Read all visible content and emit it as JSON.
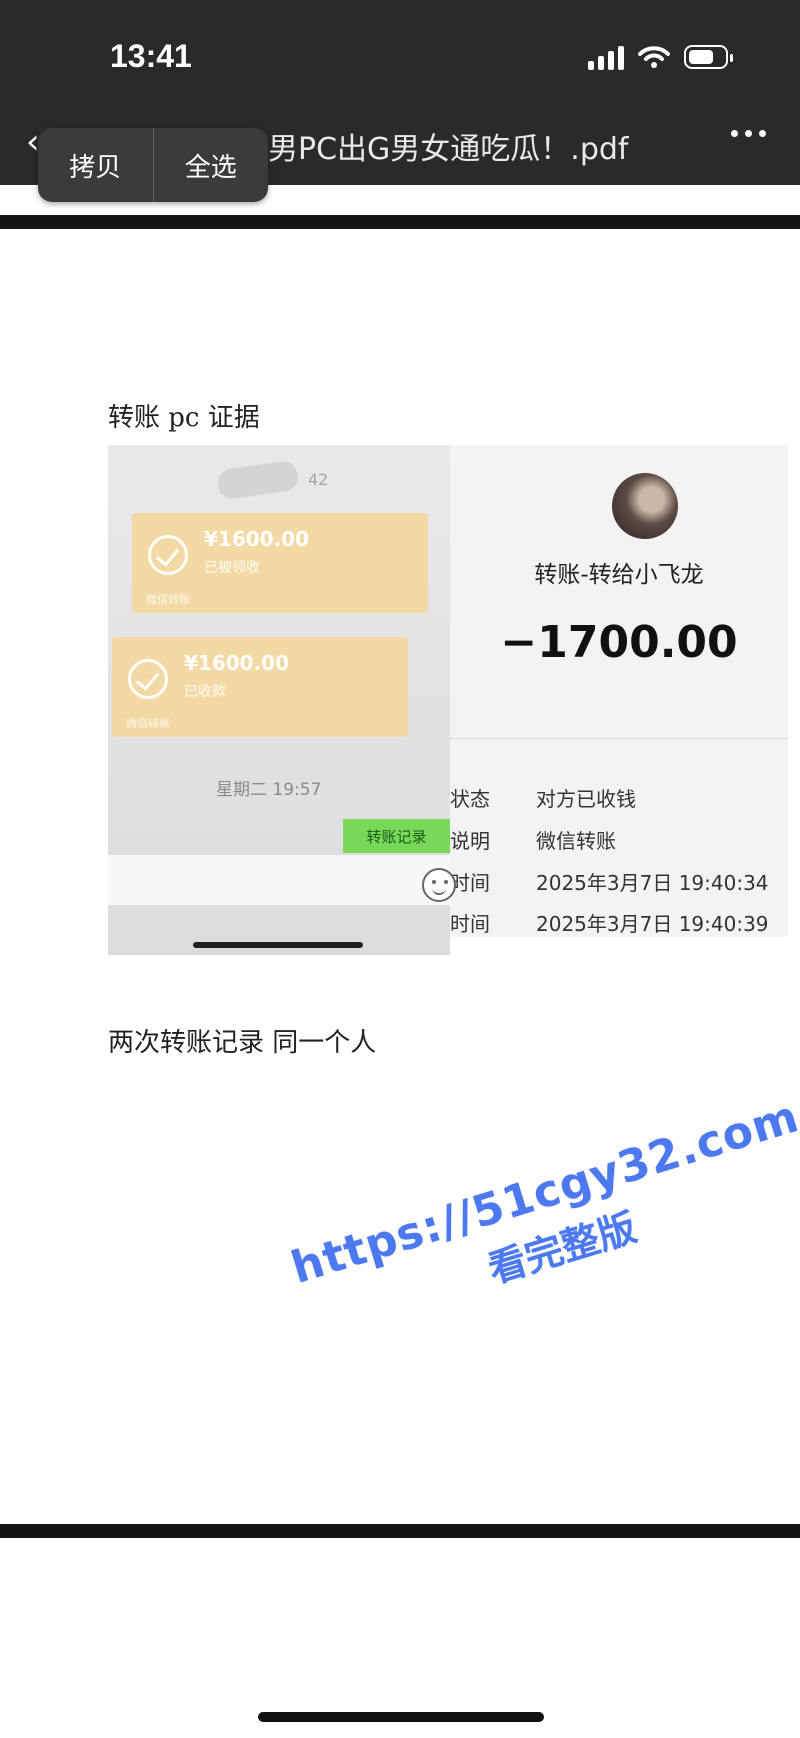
{
  "status_bar": {
    "time": "13:41"
  },
  "nav": {
    "back_label": "‹",
    "title": "男PC出G男女通吃瓜！.pdf"
  },
  "context_menu": {
    "copy": "拷贝",
    "select_all": "全选"
  },
  "document": {
    "heading": "转账 pc 证据",
    "caption": "两次转账记录  同一个人"
  },
  "left_screenshot": {
    "number": "42",
    "cards": [
      {
        "amount": "¥1600.00",
        "status": "已被领收",
        "footer": "微信转账"
      },
      {
        "amount": "¥1600.00",
        "status": "已收款",
        "footer": "微信转账"
      }
    ],
    "time": "星期二 19:57",
    "green_tag": "转账记录"
  },
  "right_screenshot": {
    "title": "转账-转给小飞龙",
    "amount": "−1700.00",
    "rows": [
      {
        "key": "状态",
        "value": "对方已收钱"
      },
      {
        "key": "说明",
        "value": "微信转账"
      },
      {
        "key": "时间",
        "value": "2025年3月7日 19:40:34"
      },
      {
        "key": "时间",
        "value": "2025年3月7日 19:40:39"
      }
    ]
  },
  "watermark": {
    "line1": "https://51cgy32.com",
    "line2": "看完整版"
  },
  "colors": {
    "chrome": "#2a2a2c",
    "watermark": "#4c78f0",
    "card": "#f3d9a4",
    "green": "#78d85a"
  }
}
